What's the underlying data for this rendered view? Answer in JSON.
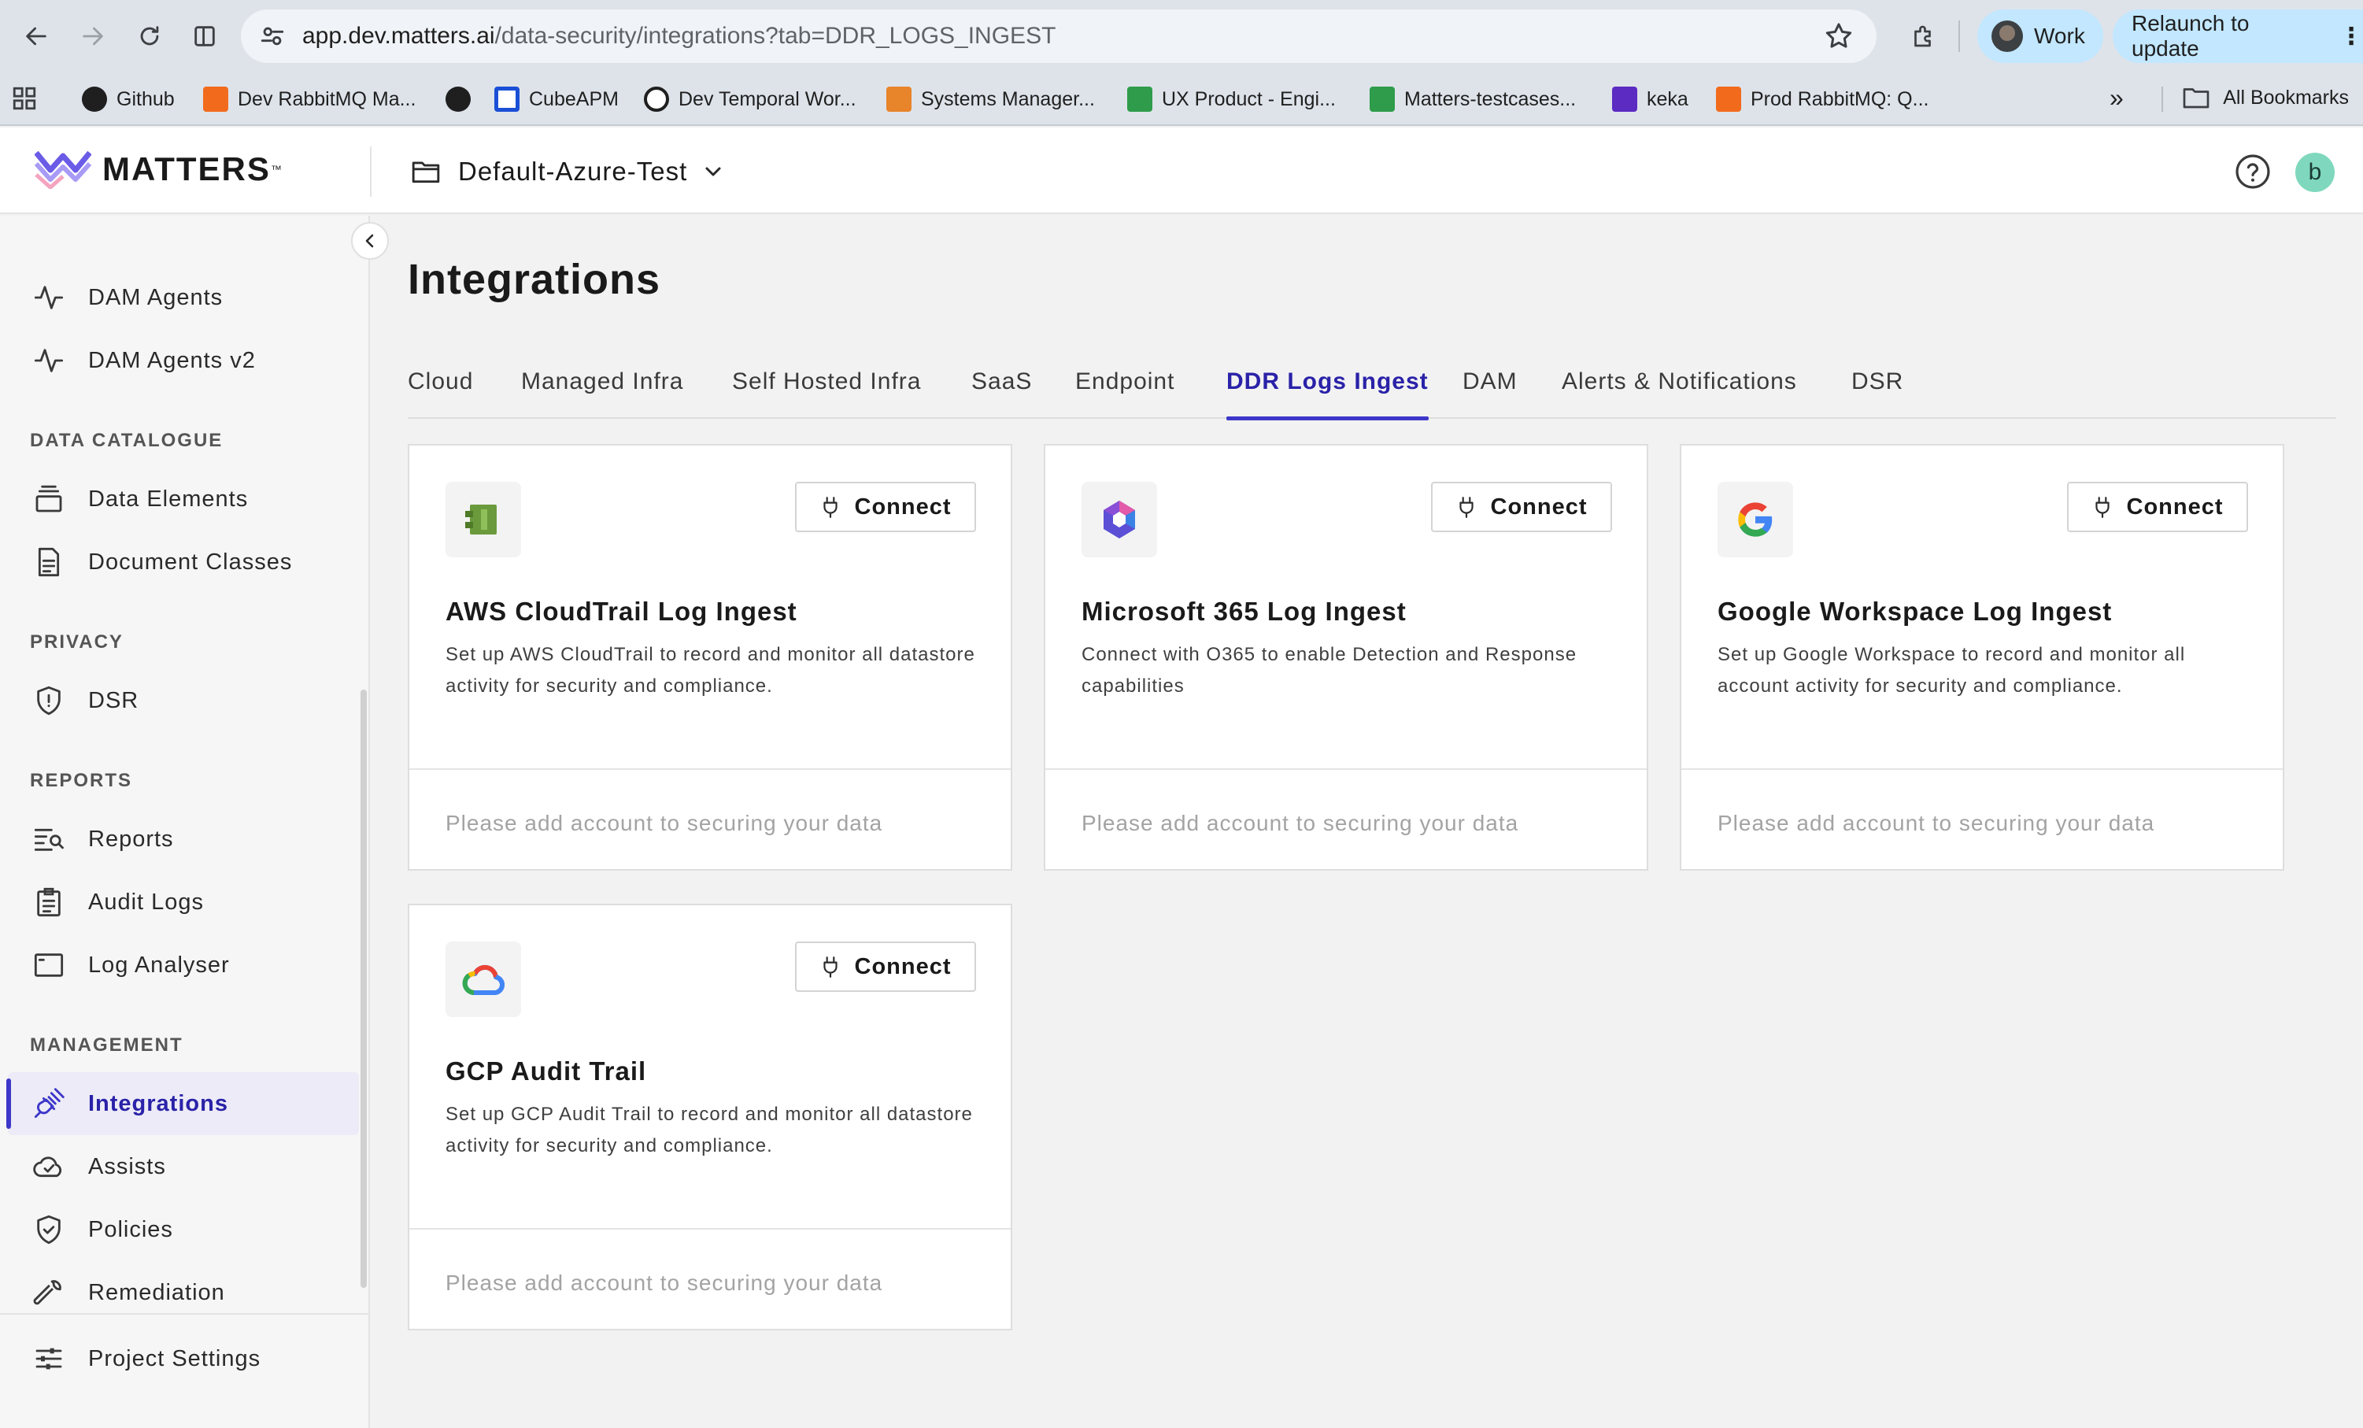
{
  "browser": {
    "url_host": "app.dev.matters.ai",
    "url_path": "/data-security/integrations?tab=DDR_LOGS_INGEST",
    "profile_label": "Work",
    "relaunch_label": "Relaunch to update",
    "bookmarks": [
      {
        "label": "Github",
        "icon": "github-icon",
        "color": "#1f1f1f"
      },
      {
        "label": "Dev RabbitMQ Ma...",
        "icon": "rabbitmq-icon",
        "color": "#f26b1d"
      },
      {
        "label": "",
        "icon": "globe-icon",
        "color": "#1f1f1f"
      },
      {
        "label": "CubeAPM",
        "icon": "cubeapm-icon",
        "color": "#1a4fd6"
      },
      {
        "label": "Dev Temporal Wor...",
        "icon": "temporal-icon",
        "color": "#1f1f1f"
      },
      {
        "label": "Systems Manager...",
        "icon": "aws-systems-manager-icon",
        "color": "#e8842a"
      },
      {
        "label": "UX Product - Engi...",
        "icon": "sheet-icon",
        "color": "#2e9c4a"
      },
      {
        "label": "Matters-testcases...",
        "icon": "sheet-icon",
        "color": "#2e9c4a"
      },
      {
        "label": "keka",
        "icon": "keka-icon",
        "color": "#5b2bc2"
      },
      {
        "label": "Prod RabbitMQ: Q...",
        "icon": "rabbitmq-icon",
        "color": "#f26b1d"
      }
    ],
    "all_bookmarks_label": "All Bookmarks"
  },
  "header": {
    "brand": "MATTERS",
    "project": "Default-Azure-Test",
    "avatar_initial": "b"
  },
  "sidebar": {
    "items_top": [
      {
        "label": "DAM Agents",
        "icon": "pulse-icon"
      },
      {
        "label": "DAM Agents v2",
        "icon": "pulse-icon"
      }
    ],
    "sections": {
      "data_catalogue": "DATA CATALOGUE",
      "privacy": "PRIVACY",
      "reports": "REPORTS",
      "management": "MANAGEMENT"
    },
    "data_catalogue_items": [
      {
        "label": "Data Elements",
        "icon": "stack-icon"
      },
      {
        "label": "Document Classes",
        "icon": "document-icon"
      }
    ],
    "privacy_items": [
      {
        "label": "DSR",
        "icon": "shield-icon"
      }
    ],
    "reports_items": [
      {
        "label": "Reports",
        "icon": "report-search-icon"
      },
      {
        "label": "Audit Logs",
        "icon": "clipboard-icon"
      },
      {
        "label": "Log Analyser",
        "icon": "window-icon"
      }
    ],
    "management_items": [
      {
        "label": "Integrations",
        "icon": "plug-icon",
        "active": true
      },
      {
        "label": "Assists",
        "icon": "check-cloud-icon"
      },
      {
        "label": "Policies",
        "icon": "shield-check-icon"
      },
      {
        "label": "Remediation",
        "icon": "wrench-icon"
      }
    ],
    "footer_item": {
      "label": "Project Settings",
      "icon": "sliders-icon"
    }
  },
  "main": {
    "title": "Integrations",
    "tabs": [
      {
        "label": "Cloud"
      },
      {
        "label": "Managed Infra"
      },
      {
        "label": "Self Hosted Infra"
      },
      {
        "label": "SaaS"
      },
      {
        "label": "Endpoint"
      },
      {
        "label": "DDR Logs Ingest",
        "active": true
      },
      {
        "label": "DAM"
      },
      {
        "label": "Alerts & Notifications"
      },
      {
        "label": "DSR"
      }
    ],
    "connect_label": "Connect",
    "cards": [
      {
        "title": "AWS CloudTrail Log Ingest",
        "description": "Set up AWS CloudTrail to record and monitor all datastore activity for security and compliance.",
        "footer": "Please add account to securing your data",
        "icon": "aws-cloudtrail-icon"
      },
      {
        "title": "Microsoft 365 Log Ingest",
        "description": "Connect with O365 to enable Detection and Response capabilities",
        "footer": "Please add account to securing your data",
        "icon": "microsoft-365-icon"
      },
      {
        "title": "Google Workspace Log Ingest",
        "description": "Set up Google Workspace to record and monitor all account activity for security and compliance.",
        "footer": "Please add account to securing your data",
        "icon": "google-icon"
      },
      {
        "title": "GCP Audit Trail",
        "description": "Set up GCP Audit Trail to record and monitor all datastore activity for security and compliance.",
        "footer": "Please add account to securing your data",
        "icon": "google-cloud-icon"
      }
    ]
  },
  "colors": {
    "accent": "#3d36c9",
    "accent_text": "#2a22a8",
    "chrome_bg": "#dee3ea",
    "chip_bg": "#c2e7ff",
    "avatar_bg": "#7fd8bd"
  }
}
